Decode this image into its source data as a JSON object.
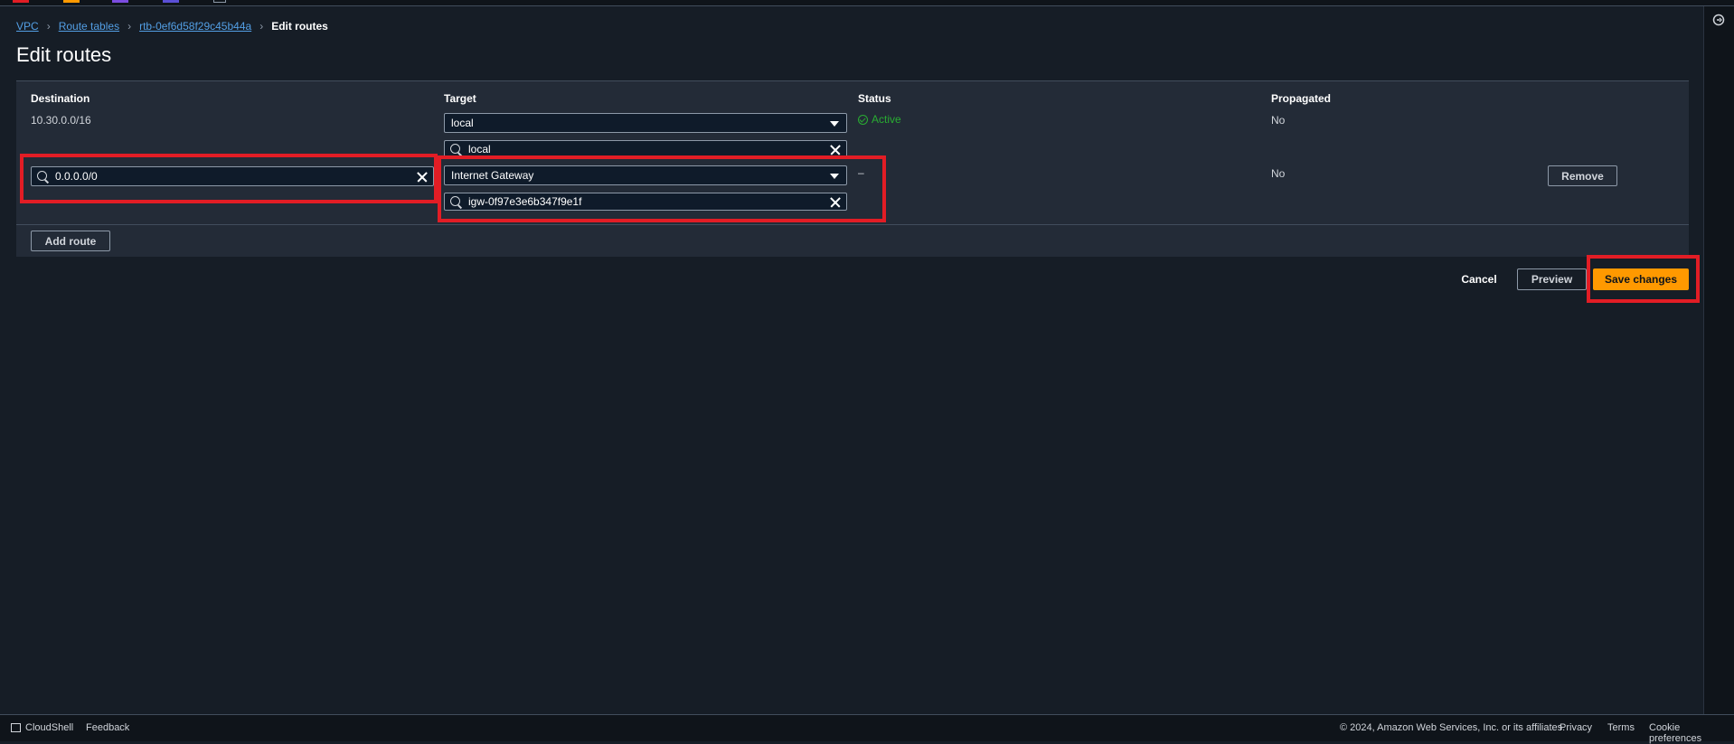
{
  "breadcrumb": {
    "vpc": "VPC",
    "route_tables": "Route tables",
    "route_table_id": "rtb-0ef6d58f29c45b44a",
    "current": "Edit routes"
  },
  "page": {
    "title": "Edit routes"
  },
  "table": {
    "headers": {
      "destination": "Destination",
      "target": "Target",
      "status": "Status",
      "propagated": "Propagated"
    },
    "rows": [
      {
        "destination": "10.30.0.0/16",
        "target_type": "local",
        "target_value": "local",
        "status": "Active",
        "propagated": "No"
      },
      {
        "destination": "0.0.0.0/0",
        "target_type": "Internet Gateway",
        "target_value": "igw-0f97e3e6b347f9e1f",
        "status": "–",
        "propagated": "No",
        "remove_label": "Remove"
      }
    ]
  },
  "actions": {
    "add_route": "Add route",
    "cancel": "Cancel",
    "preview": "Preview",
    "save": "Save changes"
  },
  "footer": {
    "cloudshell": "CloudShell",
    "feedback": "Feedback",
    "copyright": "© 2024, Amazon Web Services, Inc. or its affiliates.",
    "privacy": "Privacy",
    "terms": "Terms",
    "cookie": "Cookie preferences"
  },
  "colors": {
    "accent": "#ff9900",
    "link": "#539fe5",
    "success": "#29ad32",
    "highlight": "#e21d25"
  }
}
